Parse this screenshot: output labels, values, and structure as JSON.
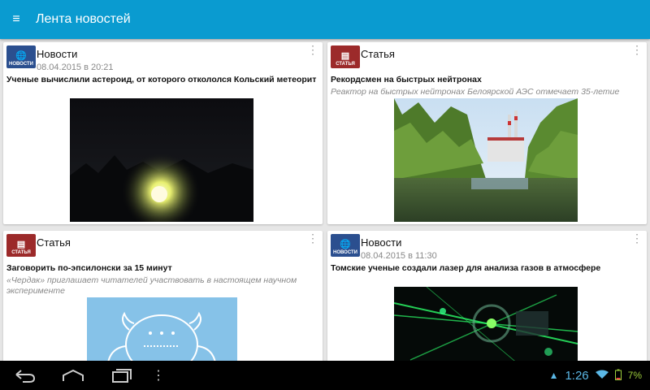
{
  "app": {
    "title": "Лента новостей"
  },
  "feed": [
    {
      "type": "news",
      "badge": "НОВОСТИ",
      "type_label": "Новости",
      "date": "08.04.2015 в 20:21",
      "headline": "Ученые вычислили астероид, от которого откололся Кольский метеорит",
      "subtitle": "",
      "image": "meteor-photo"
    },
    {
      "type": "article",
      "badge": "СТАТЬЯ",
      "type_label": "Статья",
      "date": "",
      "headline": "Рекордсмен на быстрых нейтронах",
      "subtitle": "Реактор на быстрых нейтронах Белоярской АЭС отмечает 35-летие",
      "image": "reactor-photo"
    },
    {
      "type": "article",
      "badge": "СТАТЬЯ",
      "type_label": "Статья",
      "date": "",
      "headline": "Заговорить по-эпсилонски за 15 минут",
      "subtitle": "«Чердак» приглашает читателей участвовать в настоящем научном эксперименте",
      "image": "creature-illustration"
    },
    {
      "type": "news",
      "badge": "НОВОСТИ",
      "type_label": "Новости",
      "date": "08.04.2015 в 11:30",
      "headline": "Томские ученые создали лазер для анализа газов в атмосфере",
      "subtitle": "",
      "image": "laser-photo"
    }
  ],
  "statusbar": {
    "time": "1:26",
    "battery": "7%"
  },
  "icons": {
    "menu": "menu-icon",
    "back": "back-icon",
    "home": "home-icon",
    "recents": "recents-icon",
    "more": "more-vert-icon",
    "globe": "globe-icon",
    "article": "article-icon",
    "wifi": "wifi-icon",
    "battery": "battery-icon",
    "notification": "notification-icon"
  },
  "colors": {
    "appbar": "#0a9bd0",
    "news_badge": "#2b4f8f",
    "article_badge": "#9c2a2a",
    "background": "#e6e6e6"
  }
}
